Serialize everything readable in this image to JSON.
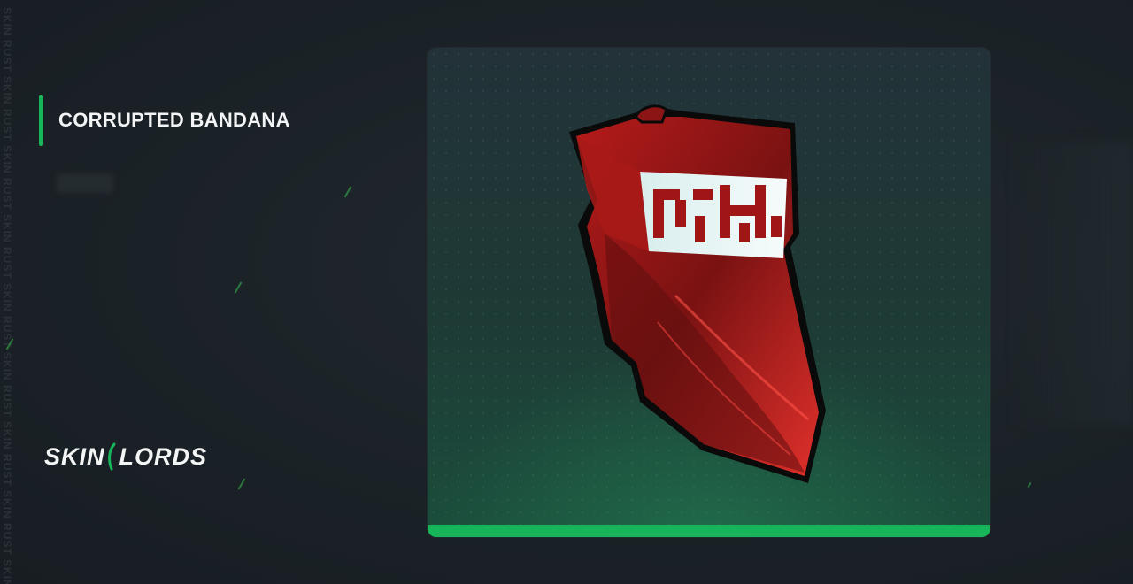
{
  "side_watermark": "SKIN RUST SKIN RUST SKIN RUST SKIN RUST SKIN RUST SKIN RUST SKIN RUST SKIN RUST SKIN",
  "item": {
    "name": "CORRUPTED BANDANA",
    "image_icon": "red-bandana-icon"
  },
  "brand": {
    "left": "SKIN",
    "right": "LORDS",
    "logo_icon": "skinlords-logo-icon"
  },
  "colors": {
    "accent": "#17b55a",
    "background": "#1b2227",
    "card_top": "#223238",
    "card_bottom": "#1b4e3c",
    "bandana_red": "#c8201f",
    "pattern_white": "#eaf6f6"
  }
}
